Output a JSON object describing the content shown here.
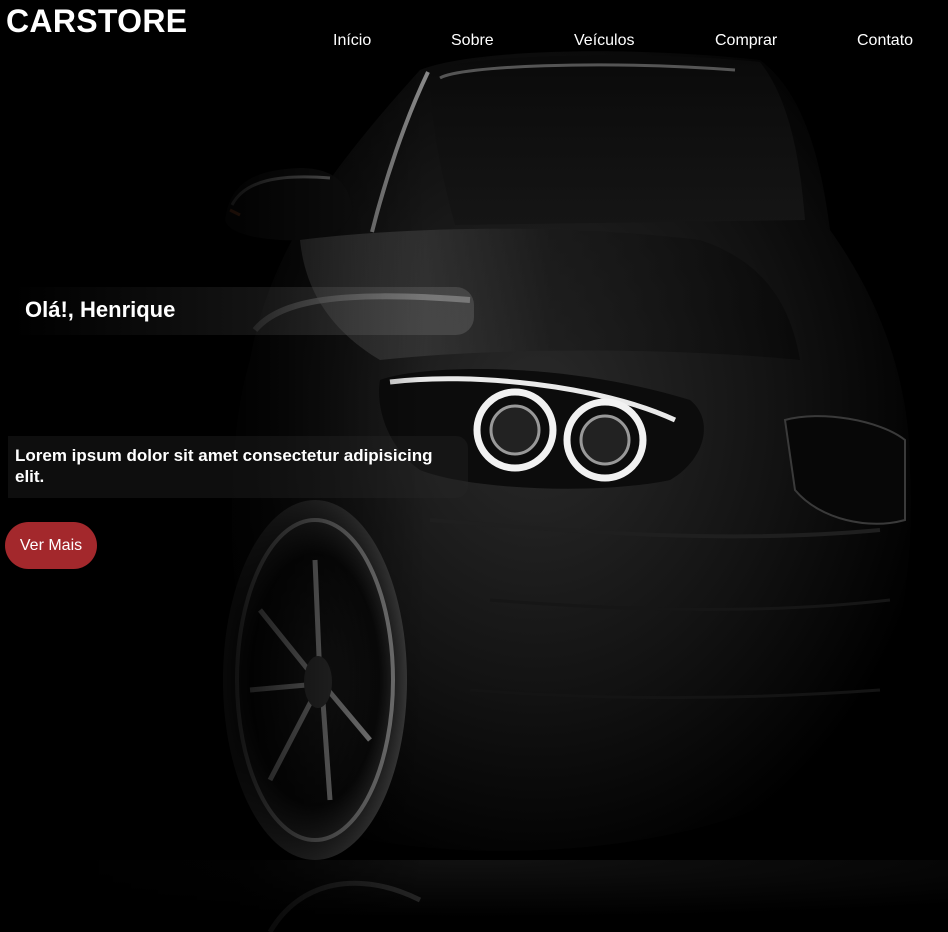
{
  "header": {
    "logo": "CARSTORE",
    "nav": [
      "Início",
      "Sobre",
      "Veículos",
      "Comprar",
      "Contato"
    ]
  },
  "hero": {
    "greeting": "Olá!, Henrique",
    "intro": "Lorem ipsum dolor sit amet consectetur adipisicing elit.",
    "cta_label": "Ver Mais",
    "background_image": "black sports car front three-quarter view with glowing headlights on black background"
  },
  "colors": {
    "background": "#000000",
    "text": "#ffffff",
    "cta": "#a3282c"
  }
}
